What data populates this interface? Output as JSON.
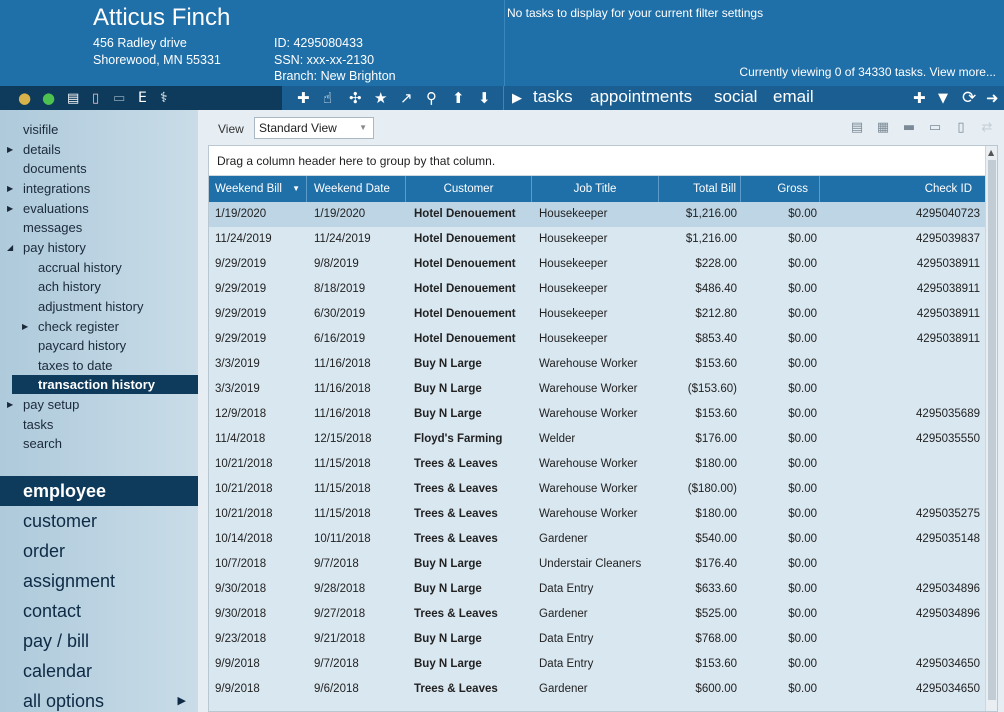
{
  "employee": {
    "name": "Atticus Finch",
    "address1": "456 Radley drive",
    "address2": "Shorewood, MN 55331",
    "id_label": "ID:",
    "id_value": "4295080433",
    "ssn_label": "SSN:",
    "ssn_value": "xxx-xx-2130",
    "branch_label": "Branch:",
    "branch_value": "New Brighton"
  },
  "tasks": {
    "empty_message": "No tasks to display for your current filter settings",
    "viewing_text": "Currently viewing 0 of 34330 tasks. View more...",
    "tabs": [
      "tasks",
      "appointments",
      "social",
      "email"
    ]
  },
  "icons": {
    "left_strip": [
      "coin-icon",
      "green-status-icon",
      "clipboard-icon",
      "pdf-document-icon",
      "id-card-icon",
      "e-verify-icon",
      "caduceus-icon"
    ],
    "left_strip_glyphs": [
      "●",
      "●",
      "▤",
      "▯",
      "▭",
      "E",
      "⚕"
    ],
    "mid_strip": [
      "add-icon",
      "hand-pointer-icon",
      "puzzle-icon",
      "star-icon",
      "open-external-icon",
      "search-icon",
      "arrow-up-icon",
      "arrow-down-icon"
    ],
    "mid_strip_glyphs": [
      "✚",
      "☝",
      "✣",
      "★",
      "↗",
      "⚲",
      "⬆",
      "⬇"
    ],
    "right_strip": [
      "add-task-icon",
      "filter-icon",
      "refresh-icon",
      "arrow-right-icon"
    ],
    "right_strip_glyphs": [
      "✚",
      "▼",
      "⟳",
      "➜"
    ],
    "play_glyph": "▶"
  },
  "sidebar": {
    "items": [
      {
        "label": "visifile",
        "indent": 0,
        "arrow": ""
      },
      {
        "label": "details",
        "indent": 0,
        "arrow": "▶"
      },
      {
        "label": "documents",
        "indent": 0,
        "arrow": ""
      },
      {
        "label": "integrations",
        "indent": 0,
        "arrow": "▶"
      },
      {
        "label": "evaluations",
        "indent": 0,
        "arrow": "▶"
      },
      {
        "label": "messages",
        "indent": 0,
        "arrow": ""
      },
      {
        "label": "pay history",
        "indent": 0,
        "arrow": "◢"
      },
      {
        "label": "accrual history",
        "indent": 1,
        "arrow": ""
      },
      {
        "label": "ach history",
        "indent": 1,
        "arrow": ""
      },
      {
        "label": "adjustment history",
        "indent": 1,
        "arrow": ""
      },
      {
        "label": "check register",
        "indent": 1,
        "arrow": "▶"
      },
      {
        "label": "paycard history",
        "indent": 1,
        "arrow": ""
      },
      {
        "label": "taxes to date",
        "indent": 1,
        "arrow": ""
      },
      {
        "label": "transaction history",
        "indent": 1,
        "arrow": "",
        "selected": true
      },
      {
        "label": "pay setup",
        "indent": 0,
        "arrow": "▶"
      },
      {
        "label": "tasks",
        "indent": 0,
        "arrow": ""
      },
      {
        "label": "search",
        "indent": 0,
        "arrow": ""
      }
    ],
    "big_items": [
      {
        "label": "employee",
        "selected": true
      },
      {
        "label": "customer"
      },
      {
        "label": "order"
      },
      {
        "label": "assignment"
      },
      {
        "label": "contact"
      },
      {
        "label": "pay / bill"
      },
      {
        "label": "calendar"
      },
      {
        "label": "all options",
        "arrow": "▶"
      }
    ]
  },
  "view": {
    "label": "View",
    "selected": "Standard View",
    "caret": "▼"
  },
  "toolbar_icons": [
    "report-icon",
    "building-icon",
    "folder-icon",
    "card-icon",
    "document-icon",
    "transfer-icon"
  ],
  "toolbar_glyphs": [
    "▤",
    "▦",
    "▬",
    "▭",
    "▯",
    "⇄"
  ],
  "grid": {
    "group_hint": "Drag a column header here to group by that column.",
    "columns": [
      "Weekend Bill",
      "Weekend Date",
      "Customer",
      "Job Title",
      "Total Bill",
      "Gross",
      "Check ID"
    ],
    "sort_glyph": "▼",
    "rows": [
      [
        "1/19/2020",
        "1/19/2020",
        "Hotel Denouement",
        "Housekeeper",
        "$1,216.00",
        "$0.00",
        "4295040723"
      ],
      [
        "11/24/2019",
        "11/24/2019",
        "Hotel Denouement",
        "Housekeeper",
        "$1,216.00",
        "$0.00",
        "4295039837"
      ],
      [
        "9/29/2019",
        "9/8/2019",
        "Hotel Denouement",
        "Housekeeper",
        "$228.00",
        "$0.00",
        "4295038911"
      ],
      [
        "9/29/2019",
        "8/18/2019",
        "Hotel Denouement",
        "Housekeeper",
        "$486.40",
        "$0.00",
        "4295038911"
      ],
      [
        "9/29/2019",
        "6/30/2019",
        "Hotel Denouement",
        "Housekeeper",
        "$212.80",
        "$0.00",
        "4295038911"
      ],
      [
        "9/29/2019",
        "6/16/2019",
        "Hotel Denouement",
        "Housekeeper",
        "$853.40",
        "$0.00",
        "4295038911"
      ],
      [
        "3/3/2019",
        "11/16/2018",
        "Buy N Large",
        "Warehouse Worker",
        "$153.60",
        "$0.00",
        ""
      ],
      [
        "3/3/2019",
        "11/16/2018",
        "Buy N Large",
        "Warehouse Worker",
        "($153.60)",
        "$0.00",
        ""
      ],
      [
        "12/9/2018",
        "11/16/2018",
        "Buy N Large",
        "Warehouse Worker",
        "$153.60",
        "$0.00",
        "4295035689"
      ],
      [
        "11/4/2018",
        "12/15/2018",
        "Floyd's Farming",
        "Welder",
        "$176.00",
        "$0.00",
        "4295035550"
      ],
      [
        "10/21/2018",
        "11/15/2018",
        "Trees & Leaves",
        "Warehouse Worker",
        "$180.00",
        "$0.00",
        ""
      ],
      [
        "10/21/2018",
        "11/15/2018",
        "Trees & Leaves",
        "Warehouse Worker",
        "($180.00)",
        "$0.00",
        ""
      ],
      [
        "10/21/2018",
        "11/15/2018",
        "Trees & Leaves",
        "Warehouse Worker",
        "$180.00",
        "$0.00",
        "4295035275"
      ],
      [
        "10/14/2018",
        "10/11/2018",
        "Trees & Leaves",
        "Gardener",
        "$540.00",
        "$0.00",
        "4295035148"
      ],
      [
        "10/7/2018",
        "9/7/2018",
        "Buy N Large",
        "Understair Cleaners",
        "$176.40",
        "$0.00",
        ""
      ],
      [
        "9/30/2018",
        "9/28/2018",
        "Buy N Large",
        "Data Entry",
        "$633.60",
        "$0.00",
        "4295034896"
      ],
      [
        "9/30/2018",
        "9/27/2018",
        "Trees & Leaves",
        "Gardener",
        "$525.00",
        "$0.00",
        "4295034896"
      ],
      [
        "9/23/2018",
        "9/21/2018",
        "Buy N Large",
        "Data Entry",
        "$768.00",
        "$0.00",
        ""
      ],
      [
        "9/9/2018",
        "9/7/2018",
        "Buy N Large",
        "Data Entry",
        "$153.60",
        "$0.00",
        "4295034650"
      ],
      [
        "9/9/2018",
        "9/6/2018",
        "Trees & Leaves",
        "Gardener",
        "$600.00",
        "$0.00",
        "4295034650"
      ]
    ]
  }
}
